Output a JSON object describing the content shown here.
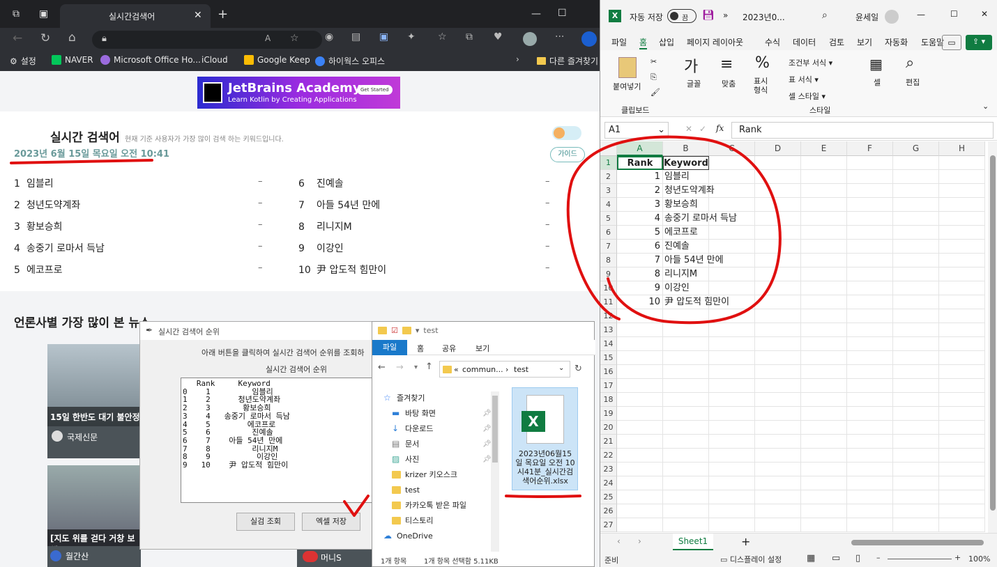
{
  "browser": {
    "tab_title": "실시간검색어",
    "bookmarks": [
      "설정",
      "NAVER",
      "Microsoft Office Ho...",
      "iCloud",
      "Google Keep",
      "하이웍스 오피스",
      "다른 즐겨찾기"
    ],
    "ad": {
      "title": "JetBrains Academy",
      "subtitle": "Learn Kotlin by Creating Applications",
      "cta": "Get Started"
    },
    "realtime": {
      "title": "실시간 검색어",
      "subtitle": "현재 기준 사용자가 가장 많이 검색 하는 키워드입니다.",
      "date": "2023년 6월 15일 목요일 오전 10:41",
      "guide": "가이드",
      "left": [
        {
          "rank": "1",
          "kw": "임블리"
        },
        {
          "rank": "2",
          "kw": "청년도약계좌"
        },
        {
          "rank": "3",
          "kw": "황보승희"
        },
        {
          "rank": "4",
          "kw": "송중기 로마서 득남"
        },
        {
          "rank": "5",
          "kw": "에코프로"
        }
      ],
      "right": [
        {
          "rank": "6",
          "kw": "진예솔"
        },
        {
          "rank": "7",
          "kw": "아들 54년 만에"
        },
        {
          "rank": "8",
          "kw": "리니지M"
        },
        {
          "rank": "9",
          "kw": "이강인"
        },
        {
          "rank": "10",
          "kw": "尹 압도적 힘만이"
        }
      ],
      "dash": "–"
    },
    "news": {
      "title": "언론사별 가장 많이 본 뉴스",
      "card1_caption": "15일 한반도 대기 불안정",
      "card1_source": "국제신문",
      "card2_caption": "[지도 위를 걷다 거창 보해",
      "card2_source": "월간산",
      "card3_source": "머니S"
    }
  },
  "tk_dialog": {
    "title": "실시간 검색어 순위",
    "instruction": "아래 버튼을 클릭하여 실시간 검색어 순위를 조회하",
    "list_label": "실시간 검색어 순위",
    "table_text": "   Rank     Keyword\n0    1         임블리\n1    2      청년도약계좌\n2    3       황보승희\n3    4   송중기 로마서 득남\n4    5        에코프로\n5    6         진예솔\n6    7    아들 54년 만에\n7    8         리니지M\n8    9          이강인\n9   10    尹 압도적 힘만이",
    "btn_search": "실검 조회",
    "btn_excel": "엑셀 저장"
  },
  "explorer": {
    "title": "test",
    "ribbon": [
      "파일",
      "홈",
      "공유",
      "보기"
    ],
    "path_a": "commun...",
    "path_b": "test",
    "nav": [
      "즐겨찾기",
      "바탕 화면",
      "다운로드",
      "문서",
      "사진",
      "krizer 키오스크",
      "test",
      "카카오톡 받은 파일",
      "티스토리",
      "OneDrive"
    ],
    "file_name": "2023년06월15일 목요일 오전 10시41분_실시간검색어순위.xlsx",
    "status_items": "1개 항목",
    "status_selected": "1개 항목 선택함 5.11KB"
  },
  "excel": {
    "autosave": "자동 저장",
    "autosave_state": "끔",
    "doc_title": "2023년0...",
    "user": "윤세일",
    "tabs": [
      "파일",
      "홈",
      "삽입",
      "페이지 레이아웃",
      "수식",
      "데이터",
      "검토",
      "보기",
      "자동화",
      "도움말"
    ],
    "ribbon": {
      "paste": "붙여넣기",
      "clipboard": "클립보드",
      "font": "글꼴",
      "align": "맞춤",
      "number": "표시 형식",
      "cond": "조건부 서식",
      "table": "표 서식",
      "cellstyle": "셀 스타일",
      "styles": "스타일",
      "cells": "셀",
      "edit": "편집"
    },
    "namebox": "A1",
    "formula": "Rank",
    "columns": [
      "A",
      "B",
      "C",
      "D",
      "E",
      "F",
      "G",
      "H"
    ],
    "rows": [
      "1",
      "2",
      "3",
      "4",
      "5",
      "6",
      "7",
      "8",
      "9",
      "10",
      "11",
      "12",
      "13",
      "14",
      "15",
      "16",
      "17",
      "18",
      "19",
      "20",
      "21",
      "22",
      "23",
      "24",
      "25",
      "26",
      "27"
    ],
    "header": [
      "Rank",
      "Keyword"
    ],
    "data": [
      [
        "1",
        "임블리"
      ],
      [
        "2",
        "청년도약계좌"
      ],
      [
        "3",
        "황보승희"
      ],
      [
        "4",
        "송중기 로마서 득남"
      ],
      [
        "5",
        "에코프로"
      ],
      [
        "6",
        "진예솔"
      ],
      [
        "7",
        "아들 54년 만에"
      ],
      [
        "8",
        "리니지M"
      ],
      [
        "9",
        "이강인"
      ],
      [
        "10",
        "尹 압도적 힘만이"
      ]
    ],
    "sheet": "Sheet1",
    "status_ready": "준비",
    "status_display": "디스플레이 설정",
    "zoom": "100%"
  }
}
